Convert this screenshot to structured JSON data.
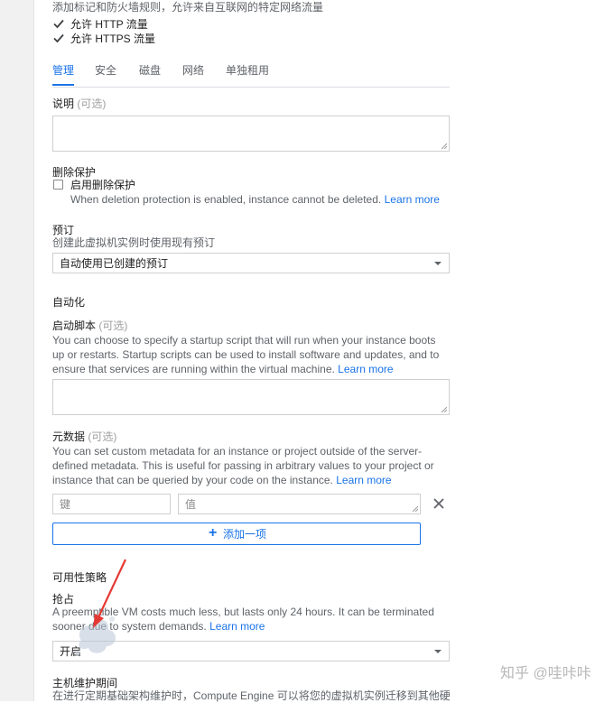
{
  "network": {
    "tags_desc": "添加标记和防火墙规则，允许来自互联网的特定网络流量",
    "allow_http": "允许 HTTP 流量",
    "allow_https": "允许 HTTPS 流量",
    "allow_http_checked": true,
    "allow_https_checked": true
  },
  "tabs": [
    {
      "label": "管理",
      "active": true
    },
    {
      "label": "安全",
      "active": false
    },
    {
      "label": "磁盘",
      "active": false
    },
    {
      "label": "网络",
      "active": false
    },
    {
      "label": "单独租用",
      "active": false
    }
  ],
  "description": {
    "label": "说明",
    "optional": "(可选)",
    "value": ""
  },
  "deletion_protection": {
    "title": "删除保护",
    "checkbox_label": "启用删除保护",
    "checked": false,
    "hint": "When deletion protection is enabled, instance cannot be deleted.",
    "learn_more": "Learn more"
  },
  "reservation": {
    "title": "预订",
    "subtitle": "创建此虚拟机实例时使用现有预订",
    "selected": "自动使用已创建的预订"
  },
  "automation": {
    "title": "自动化",
    "startup_label": "启动脚本",
    "startup_optional": "(可选)",
    "startup_desc_1": "You can choose to specify a startup script that will run when your instance boots",
    "startup_desc_2": "up or restarts. Startup scripts can be used to install software and updates, and to",
    "startup_desc_3": "ensure that services are running within the virtual machine.",
    "startup_learn_more": "Learn more"
  },
  "metadata": {
    "label": "元数据",
    "optional": "(可选)",
    "desc_1": "You can set custom metadata for an instance or project outside of the server-",
    "desc_2": "defined metadata. This is useful for passing in arbitrary values to your project or",
    "desc_3": "instance that can be queried by your code on the instance.",
    "learn_more": "Learn more",
    "key_placeholder": "键",
    "value_placeholder": "值",
    "add_item": "添加一项"
  },
  "availability": {
    "title": "可用性策略",
    "preempt_label": "抢占",
    "preempt_desc_1": "A preemptible VM costs much less, but lasts only 24 hours. It can be terminated",
    "preempt_desc_2": "sooner due to system demands.",
    "preempt_learn_more": "Learn more",
    "preempt_value": "开启",
    "maintenance_label": "主机维护期间",
    "maintenance_desc": "在进行定期基础架构维护时，Compute Engine 可以将您的虚拟机实例迁移到其他硬"
  },
  "watermark": "知乎 @哇咔咔",
  "colors": {
    "accent": "#1a73e8",
    "annotation_arrow": "#e53935"
  }
}
